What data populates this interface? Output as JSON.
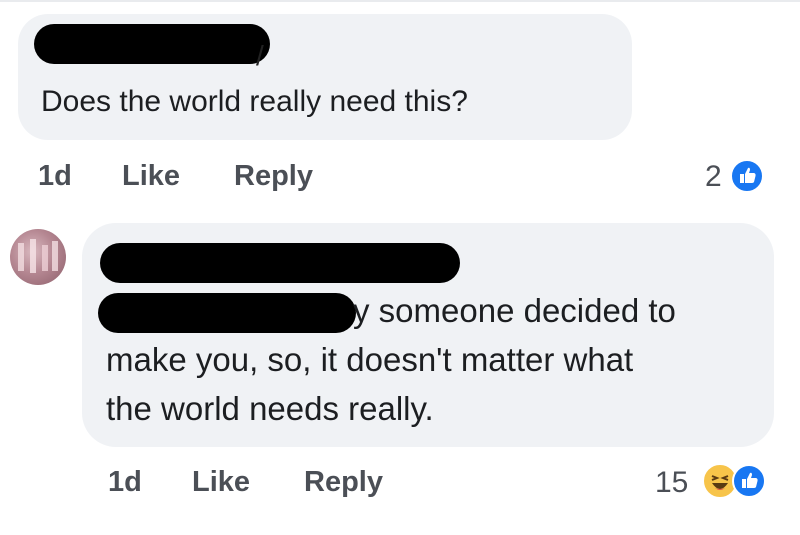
{
  "comments": [
    {
      "text": "Does the world really need this?",
      "time": "1d",
      "like_label": "Like",
      "reply_label": "Reply",
      "reaction_count": "2",
      "reactions": [
        "like-icon"
      ]
    },
    {
      "lines": [
        "y someone decided to",
        "make you, so, it doesn't matter what",
        "the world needs really."
      ],
      "time": "1d",
      "like_label": "Like",
      "reply_label": "Reply",
      "reaction_count": "15",
      "reactions": [
        "haha-icon",
        "like-icon"
      ]
    }
  ],
  "colors": {
    "bubble": "#f0f2f5",
    "like_blue": "#1877f2",
    "haha_yellow": "#f7c44a",
    "meta_text": "#4b4f56"
  }
}
